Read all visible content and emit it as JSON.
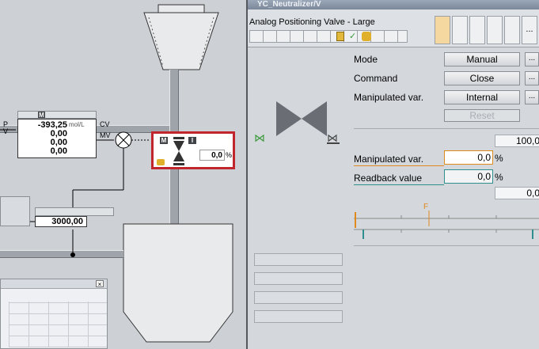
{
  "faceplate": {
    "title": "YC_Neutralizer/V",
    "block_type": "Analog Positioning Valve - Large",
    "more_label": "...",
    "rows": {
      "mode": {
        "label": "Mode",
        "value": "Manual"
      },
      "command": {
        "label": "Command",
        "value": "Close"
      },
      "manipulated_source": {
        "label": "Manipulated var.",
        "value": "Internal"
      },
      "reset": {
        "label": "Reset"
      }
    },
    "scale_high": "100,0",
    "manipulated_var": {
      "label": "Manipulated var.",
      "value": "0,0",
      "unit": "%"
    },
    "readback": {
      "label": "Readback value",
      "value": "0,0",
      "unit": "%"
    },
    "scale_low": "0,0",
    "bar_marker": "F"
  },
  "process": {
    "controller": {
      "labels_left": [
        "P",
        "V"
      ],
      "values": [
        "-393,25",
        "0,00",
        "0,00",
        "0,00"
      ],
      "unit": "mol/L",
      "cv": "CV",
      "mv": "MV",
      "mode_badge": "M"
    },
    "valve_block": {
      "value": "0,0",
      "unit": "%",
      "mode_badge": "M",
      "interlock_badge": "I"
    },
    "setpoint_block": {
      "value": "3000,00"
    }
  },
  "colors": {
    "selection": "#c0262c",
    "accent_orange": "#e08a1e",
    "accent_teal": "#2f8f8f",
    "valve_green": "#3a9a3a"
  }
}
